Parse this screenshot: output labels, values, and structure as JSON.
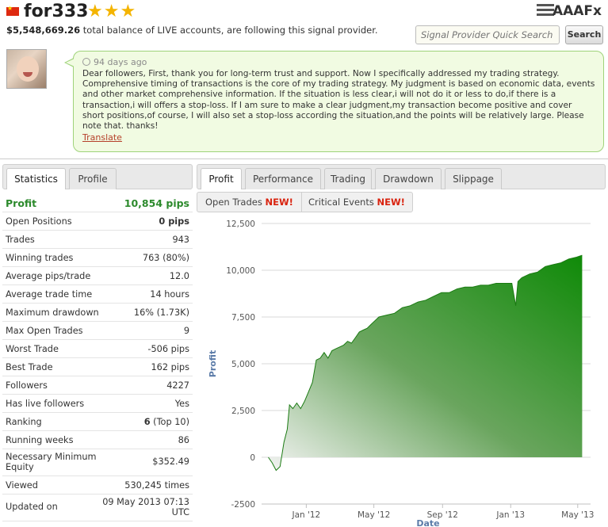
{
  "header": {
    "provider_name": "for333",
    "stars": "★★★",
    "balance": "$5,548,669.26",
    "balance_text": "total balance of LIVE accounts, are following this signal provider.",
    "brand": "AAAFx",
    "search_placeholder": "Signal Provider Quick Search",
    "search_button": "Search"
  },
  "message": {
    "time_ago": "94 days ago",
    "text": "Dear followers, First, thank you for long-term trust and support. Now I specifically addressed my trading strategy. Comprehensive timing of transactions is the core of my trading strategy. My judgment is based on economic data, events and other market comprehensive information. If the situation is less clear,i will not do it or less to do,if there is a transaction,i will offers a stop-loss. If I am sure to make a clear judgment,my transaction become positive and cover short positions,of course, I will also set a stop-loss according the situation,and the points will be relatively large. Please note that. thanks!",
    "translate_link": "Translate"
  },
  "left_tabs": [
    "Statistics",
    "Profile"
  ],
  "stats": [
    {
      "label": "Profit",
      "value": "10,854 pips"
    },
    {
      "label": "Open Positions",
      "value": "0 pips"
    },
    {
      "label": "Trades",
      "value": "943"
    },
    {
      "label": "Winning trades",
      "value": "763 (80%)"
    },
    {
      "label": "Average pips/trade",
      "value": "12.0"
    },
    {
      "label": "Average trade time",
      "value": "14 hours"
    },
    {
      "label": "Maximum drawdown",
      "value": "16% (1.73K)"
    },
    {
      "label": "Max Open Trades",
      "value": "9"
    },
    {
      "label": "Worst Trade",
      "value": "-506 pips"
    },
    {
      "label": "Best Trade",
      "value": "162 pips"
    },
    {
      "label": "Followers",
      "value": "4227"
    },
    {
      "label": "Has live followers",
      "value": "Yes"
    },
    {
      "label": "Ranking",
      "value": "6",
      "value_extra": "(Top 10)"
    },
    {
      "label": "Running weeks",
      "value": "86"
    },
    {
      "label": "Necessary Minimum Equity",
      "value": "$352.49"
    },
    {
      "label": "Viewed",
      "value": "530,245 times"
    },
    {
      "label": "Updated on",
      "value": "09 May 2013 07:13 UTC"
    }
  ],
  "right_tabs": [
    "Profit",
    "Performance",
    "Trading",
    "Drawdown",
    "Slippage"
  ],
  "sub_tabs": [
    {
      "label": "Open Trades",
      "badge": "NEW!"
    },
    {
      "label": "Critical Events",
      "badge": "NEW!"
    }
  ],
  "colors": {
    "accent_green": "#2c8a2c",
    "chart_green": "#1a8a12",
    "new_badge": "#d9230f",
    "bubble_bg": "#f1fbe2",
    "bubble_border": "#9fd37a"
  },
  "chart_data": {
    "type": "area",
    "ylabel": "Profit",
    "xlabel": "Date",
    "ylim": [
      -2500,
      12500
    ],
    "yticks": [
      -2500,
      0,
      2500,
      5000,
      7500,
      10000,
      12500
    ],
    "ytick_labels": [
      "-2500",
      "0",
      "2,500",
      "5,000",
      "7,500",
      "10,000",
      "12,500"
    ],
    "xticks": [
      "Jan '12",
      "May '12",
      "Sep '12",
      "Jan '13",
      "May '13"
    ],
    "grid": true,
    "legend": "none",
    "series": [
      {
        "x": [
          "2011-10-25",
          "2011-11-01",
          "2011-11-08",
          "2011-11-15",
          "2011-11-22",
          "2011-11-28",
          "2011-12-02",
          "2011-12-08",
          "2011-12-15",
          "2011-12-22",
          "2011-12-29",
          "2012-01-05",
          "2012-01-12",
          "2012-01-19",
          "2012-01-26",
          "2012-02-02",
          "2012-02-09",
          "2012-02-16",
          "2012-02-23",
          "2012-03-01",
          "2012-03-08",
          "2012-03-15",
          "2012-03-22",
          "2012-03-29",
          "2012-04-05",
          "2012-04-12",
          "2012-04-19",
          "2012-04-26",
          "2012-05-03",
          "2012-05-10",
          "2012-05-24",
          "2012-06-07",
          "2012-06-21",
          "2012-07-05",
          "2012-07-19",
          "2012-08-02",
          "2012-08-16",
          "2012-08-30",
          "2012-09-13",
          "2012-09-27",
          "2012-10-11",
          "2012-10-25",
          "2012-11-08",
          "2012-11-22",
          "2012-12-06",
          "2012-12-20",
          "2013-01-03",
          "2013-01-10",
          "2013-01-14",
          "2013-01-21",
          "2013-02-04",
          "2013-02-18",
          "2013-03-04",
          "2013-03-18",
          "2013-04-01",
          "2013-04-15",
          "2013-04-29",
          "2013-05-09"
        ],
        "y": [
          0,
          -300,
          -700,
          -500,
          800,
          1500,
          2800,
          2600,
          2900,
          2600,
          3000,
          3500,
          4000,
          5200,
          5300,
          5600,
          5300,
          5700,
          5800,
          5900,
          6000,
          6200,
          6100,
          6400,
          6700,
          6800,
          6900,
          7100,
          7300,
          7500,
          7600,
          7700,
          8000,
          8100,
          8300,
          8400,
          8600,
          8800,
          8800,
          9000,
          9100,
          9100,
          9200,
          9200,
          9300,
          9300,
          9300,
          8100,
          9400,
          9600,
          9800,
          9900,
          10200,
          10300,
          10400,
          10600,
          10700,
          10800
        ]
      }
    ]
  }
}
